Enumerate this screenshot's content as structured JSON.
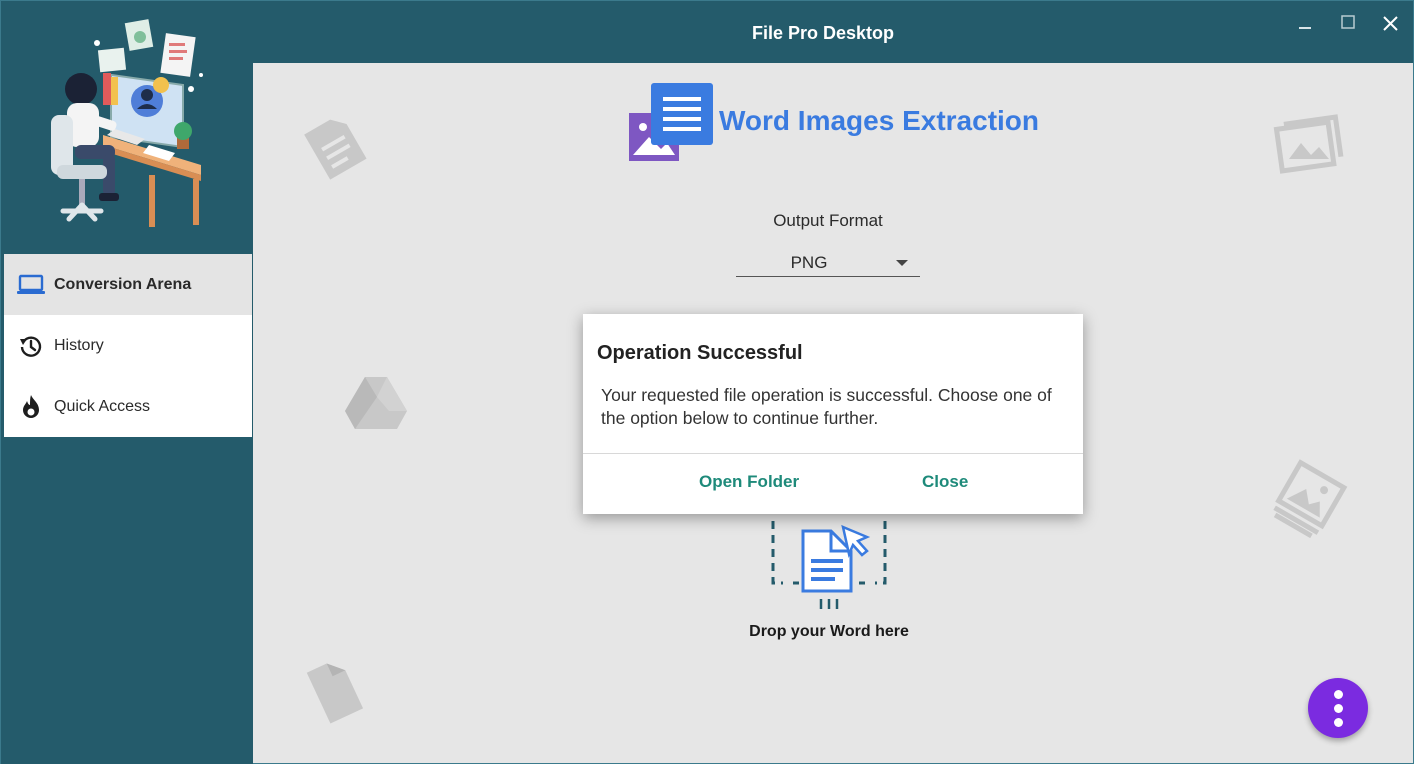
{
  "window": {
    "title": "File Pro Desktop",
    "controls": [
      "minimize-icon",
      "maximize-icon",
      "close-icon"
    ]
  },
  "sidebar": {
    "items": [
      {
        "label": "Conversion Arena",
        "icon": "laptop-icon",
        "active": true
      },
      {
        "label": "History",
        "icon": "history-icon",
        "active": false
      },
      {
        "label": "Quick Access",
        "icon": "flame-icon",
        "active": false
      }
    ]
  },
  "main": {
    "title": "Word Images Extraction",
    "output_format_label": "Output Format",
    "output_format_value": "PNG",
    "drop_text": "Drop your Word here"
  },
  "dialog": {
    "title": "Operation Successful",
    "body": "Your requested file operation is successful. Choose one of the option below to continue further.",
    "open_label": "Open Folder",
    "close_label": "Close"
  },
  "colors": {
    "sidebar": "#245b6b",
    "accent": "#3a7be0",
    "dialog_button": "#1e8a7a",
    "fab": "#7b2be0"
  }
}
